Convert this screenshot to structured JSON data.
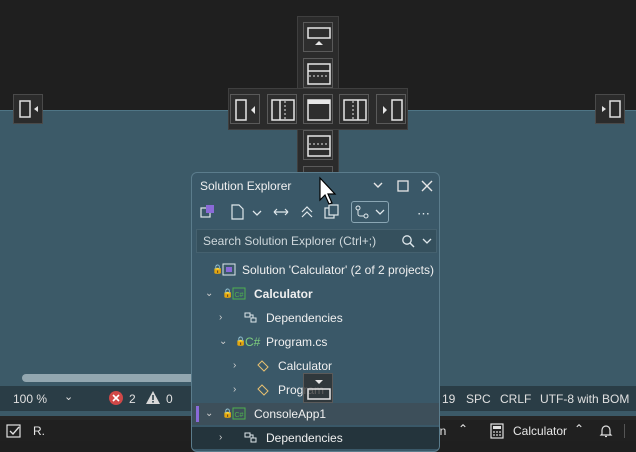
{
  "status_bar": {
    "zoom": "100 %",
    "errors": "2",
    "warnings": "0",
    "line_fragment": "19",
    "indent": "SPC",
    "line_ending": "CRLF",
    "encoding": "UTF-8 with BOM"
  },
  "taskbar": {
    "app_fragment": "R.",
    "item_fragment": "in",
    "calculator_label": "Calculator"
  },
  "solution_explorer": {
    "title": "Solution Explorer",
    "search_placeholder": "Search Solution Explorer (Ctrl+;)",
    "tree": [
      {
        "label": "Solution 'Calculator' (2 of 2 projects)"
      },
      {
        "label": "Calculator"
      },
      {
        "label": "Dependencies"
      },
      {
        "label": "Program.cs"
      },
      {
        "label": "Calculator"
      },
      {
        "label": "Program"
      },
      {
        "label": "ConsoleApp1"
      },
      {
        "label": "Dependencies"
      }
    ]
  },
  "colors": {
    "dock_preview": "#3c5a68",
    "panel": "#3a5868",
    "accent_purple": "#8a6ad8",
    "error_red": "#d04848"
  }
}
